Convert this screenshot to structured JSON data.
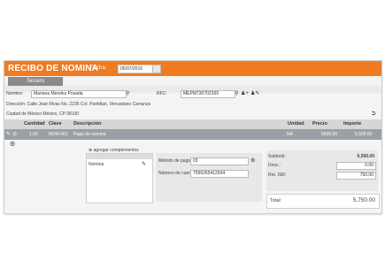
{
  "header": {
    "title": "RECIBO DE NOMINA",
    "fecha_label": "Fecha:",
    "fecha_value": "05/07/2016"
  },
  "tab": {
    "label": "Tercero"
  },
  "form": {
    "nombre_label": "Nombre:",
    "nombre_value": "Mariana Mendez Posada",
    "rfc_label": "RFC:",
    "rfc_value": "MEPM730702369",
    "direccion": "Dirección: Calle José Rivas No. 2235 Col. Pantitlan, Venustiano Carranza",
    "ciudad": "Ciudad de México México, CP 08100"
  },
  "table": {
    "headers": {
      "cantidad": "Cantidad",
      "clave": "Clave",
      "descripcion": "Descripción",
      "unidad": "Unidad",
      "precio": "Precio",
      "importe": "Importe"
    },
    "rows": [
      {
        "cantidad": "1.00",
        "clave": "NOM-001",
        "descripcion": "Pago de nómina",
        "unidad": "NA",
        "precio": "6500.00",
        "importe": "6,500.00"
      }
    ]
  },
  "complementos": {
    "add_label": "agregar complementos",
    "item_label": "Nómina"
  },
  "pago": {
    "metodo_label": "Método de pago:",
    "metodo_value": "03",
    "cuenta_label": "Número de cuenta:",
    "cuenta_value": "7596265412564"
  },
  "totales": {
    "subtotal_label": "Subtotal:",
    "subtotal_value": "6,500.00",
    "desc_label": "Desc.:",
    "desc_value": "0.00",
    "ret_label": "Ret. ISR:",
    "ret_value": "750.00",
    "total_label": "Total:",
    "total_value": "5,750.00"
  },
  "colors": {
    "accent": "#f07b23",
    "tab": "#8a8a8a",
    "row": "#9aa0a6"
  }
}
